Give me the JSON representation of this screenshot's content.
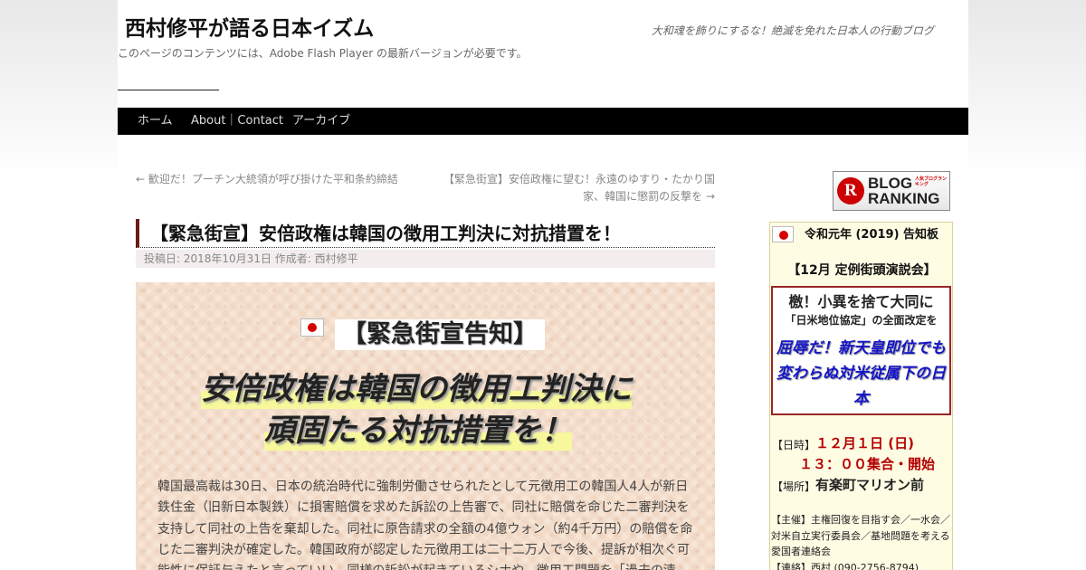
{
  "header": {
    "site_title": "西村修平が語る日本イズム",
    "tagline": "大和魂を飾りにするな！絶滅を免れた日本人の行動ブログ",
    "flash_notice": "このページのコンテンツには、Adobe Flash Player の最新バージョンが必要です。"
  },
  "nav": {
    "items": [
      "ホーム",
      "About｜Contact",
      "アーカイブ"
    ]
  },
  "post_nav": {
    "prev": "← 歓迎だ！プーチン大統領が呼び掛けた平和条約締結",
    "next_line1": "【緊急街宣】安倍政権に望む！永遠のゆすり・たかり国",
    "next_line2": "家、韓国に懲罰の反撃を →"
  },
  "post": {
    "title": "【緊急街宣】安倍政権は韓国の徴用工判決に対抗措置を！",
    "posted_label": "投稿日:",
    "date": "2018年10月31日",
    "author_label": "作成者:",
    "author": "西村修平",
    "banner": {
      "notice": "【緊急街宣告知】",
      "headline_line1": "安倍政権は韓国の徴用工判決に",
      "headline_line2": "頑固たる対抗措置を！"
    },
    "body": "韓国最高裁は30日、日本の統治時代に強制労働させられたとして元徴用工の韓国人4人が新日鉄住金（旧新日本製鉄）に損害賠償を求めた訴訟の上告審で、同社に賠償を命じた二審判決を支持して同社の上告を棄却した。同社に原告請求の全額の4億ウォン（約4千万円）の賠償を命じた二審判決が確定した。韓国政府が認定した元徴用工は二十二万人で今後、提訴が相次ぐ可能性に保証与えたと言っていい。同様の訴訟が起きているシナや、徴用工問題を「過去の清"
  },
  "sidebar": {
    "ranking": {
      "logo_letter": "R",
      "line1": "BLOG",
      "line2": "RANKING",
      "small": "人気ブログランキング"
    },
    "notice": {
      "title": "令和元年 (2019) 告知板",
      "event": "【12月 定例街頭演説会】",
      "box_line1": "檄！小異を捨て大同に",
      "box_line2": "「日米地位協定」の全面改定を",
      "box_slogan": "屈辱だ！新天皇即位でも変わらぬ対米従属下の日本",
      "date_label": "【日時】",
      "date_value": "１２月１日 (日)",
      "time_value": "１３：００集合・開始",
      "place_label": "【場所】",
      "place_value": "有楽町マリオン前",
      "organizer": "【主催】主権回復を目指す会／一水会／対米自立実行委員会／基地問題を考える愛国者連絡会",
      "contact": "【連絡】西村 (090-2756-8794)"
    }
  },
  "colors": {
    "nav_bg": "#000000",
    "accent_red": "#b40000",
    "slogan_blue": "#1515c8",
    "highlight_yellow": "#f7f89b"
  }
}
